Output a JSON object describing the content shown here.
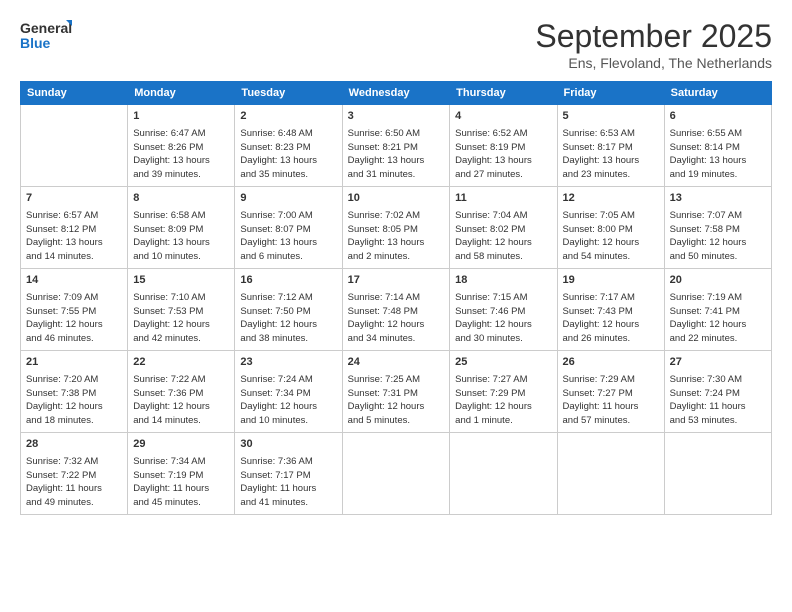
{
  "logo": {
    "line1": "General",
    "line2": "Blue"
  },
  "title": "September 2025",
  "subtitle": "Ens, Flevoland, The Netherlands",
  "days": [
    "Sunday",
    "Monday",
    "Tuesday",
    "Wednesday",
    "Thursday",
    "Friday",
    "Saturday"
  ],
  "weeks": [
    [
      {
        "date": "",
        "info": ""
      },
      {
        "date": "1",
        "info": "Sunrise: 6:47 AM\nSunset: 8:26 PM\nDaylight: 13 hours\nand 39 minutes."
      },
      {
        "date": "2",
        "info": "Sunrise: 6:48 AM\nSunset: 8:23 PM\nDaylight: 13 hours\nand 35 minutes."
      },
      {
        "date": "3",
        "info": "Sunrise: 6:50 AM\nSunset: 8:21 PM\nDaylight: 13 hours\nand 31 minutes."
      },
      {
        "date": "4",
        "info": "Sunrise: 6:52 AM\nSunset: 8:19 PM\nDaylight: 13 hours\nand 27 minutes."
      },
      {
        "date": "5",
        "info": "Sunrise: 6:53 AM\nSunset: 8:17 PM\nDaylight: 13 hours\nand 23 minutes."
      },
      {
        "date": "6",
        "info": "Sunrise: 6:55 AM\nSunset: 8:14 PM\nDaylight: 13 hours\nand 19 minutes."
      }
    ],
    [
      {
        "date": "7",
        "info": "Sunrise: 6:57 AM\nSunset: 8:12 PM\nDaylight: 13 hours\nand 14 minutes."
      },
      {
        "date": "8",
        "info": "Sunrise: 6:58 AM\nSunset: 8:09 PM\nDaylight: 13 hours\nand 10 minutes."
      },
      {
        "date": "9",
        "info": "Sunrise: 7:00 AM\nSunset: 8:07 PM\nDaylight: 13 hours\nand 6 minutes."
      },
      {
        "date": "10",
        "info": "Sunrise: 7:02 AM\nSunset: 8:05 PM\nDaylight: 13 hours\nand 2 minutes."
      },
      {
        "date": "11",
        "info": "Sunrise: 7:04 AM\nSunset: 8:02 PM\nDaylight: 12 hours\nand 58 minutes."
      },
      {
        "date": "12",
        "info": "Sunrise: 7:05 AM\nSunset: 8:00 PM\nDaylight: 12 hours\nand 54 minutes."
      },
      {
        "date": "13",
        "info": "Sunrise: 7:07 AM\nSunset: 7:58 PM\nDaylight: 12 hours\nand 50 minutes."
      }
    ],
    [
      {
        "date": "14",
        "info": "Sunrise: 7:09 AM\nSunset: 7:55 PM\nDaylight: 12 hours\nand 46 minutes."
      },
      {
        "date": "15",
        "info": "Sunrise: 7:10 AM\nSunset: 7:53 PM\nDaylight: 12 hours\nand 42 minutes."
      },
      {
        "date": "16",
        "info": "Sunrise: 7:12 AM\nSunset: 7:50 PM\nDaylight: 12 hours\nand 38 minutes."
      },
      {
        "date": "17",
        "info": "Sunrise: 7:14 AM\nSunset: 7:48 PM\nDaylight: 12 hours\nand 34 minutes."
      },
      {
        "date": "18",
        "info": "Sunrise: 7:15 AM\nSunset: 7:46 PM\nDaylight: 12 hours\nand 30 minutes."
      },
      {
        "date": "19",
        "info": "Sunrise: 7:17 AM\nSunset: 7:43 PM\nDaylight: 12 hours\nand 26 minutes."
      },
      {
        "date": "20",
        "info": "Sunrise: 7:19 AM\nSunset: 7:41 PM\nDaylight: 12 hours\nand 22 minutes."
      }
    ],
    [
      {
        "date": "21",
        "info": "Sunrise: 7:20 AM\nSunset: 7:38 PM\nDaylight: 12 hours\nand 18 minutes."
      },
      {
        "date": "22",
        "info": "Sunrise: 7:22 AM\nSunset: 7:36 PM\nDaylight: 12 hours\nand 14 minutes."
      },
      {
        "date": "23",
        "info": "Sunrise: 7:24 AM\nSunset: 7:34 PM\nDaylight: 12 hours\nand 10 minutes."
      },
      {
        "date": "24",
        "info": "Sunrise: 7:25 AM\nSunset: 7:31 PM\nDaylight: 12 hours\nand 5 minutes."
      },
      {
        "date": "25",
        "info": "Sunrise: 7:27 AM\nSunset: 7:29 PM\nDaylight: 12 hours\nand 1 minute."
      },
      {
        "date": "26",
        "info": "Sunrise: 7:29 AM\nSunset: 7:27 PM\nDaylight: 11 hours\nand 57 minutes."
      },
      {
        "date": "27",
        "info": "Sunrise: 7:30 AM\nSunset: 7:24 PM\nDaylight: 11 hours\nand 53 minutes."
      }
    ],
    [
      {
        "date": "28",
        "info": "Sunrise: 7:32 AM\nSunset: 7:22 PM\nDaylight: 11 hours\nand 49 minutes."
      },
      {
        "date": "29",
        "info": "Sunrise: 7:34 AM\nSunset: 7:19 PM\nDaylight: 11 hours\nand 45 minutes."
      },
      {
        "date": "30",
        "info": "Sunrise: 7:36 AM\nSunset: 7:17 PM\nDaylight: 11 hours\nand 41 minutes."
      },
      {
        "date": "",
        "info": ""
      },
      {
        "date": "",
        "info": ""
      },
      {
        "date": "",
        "info": ""
      },
      {
        "date": "",
        "info": ""
      }
    ]
  ]
}
